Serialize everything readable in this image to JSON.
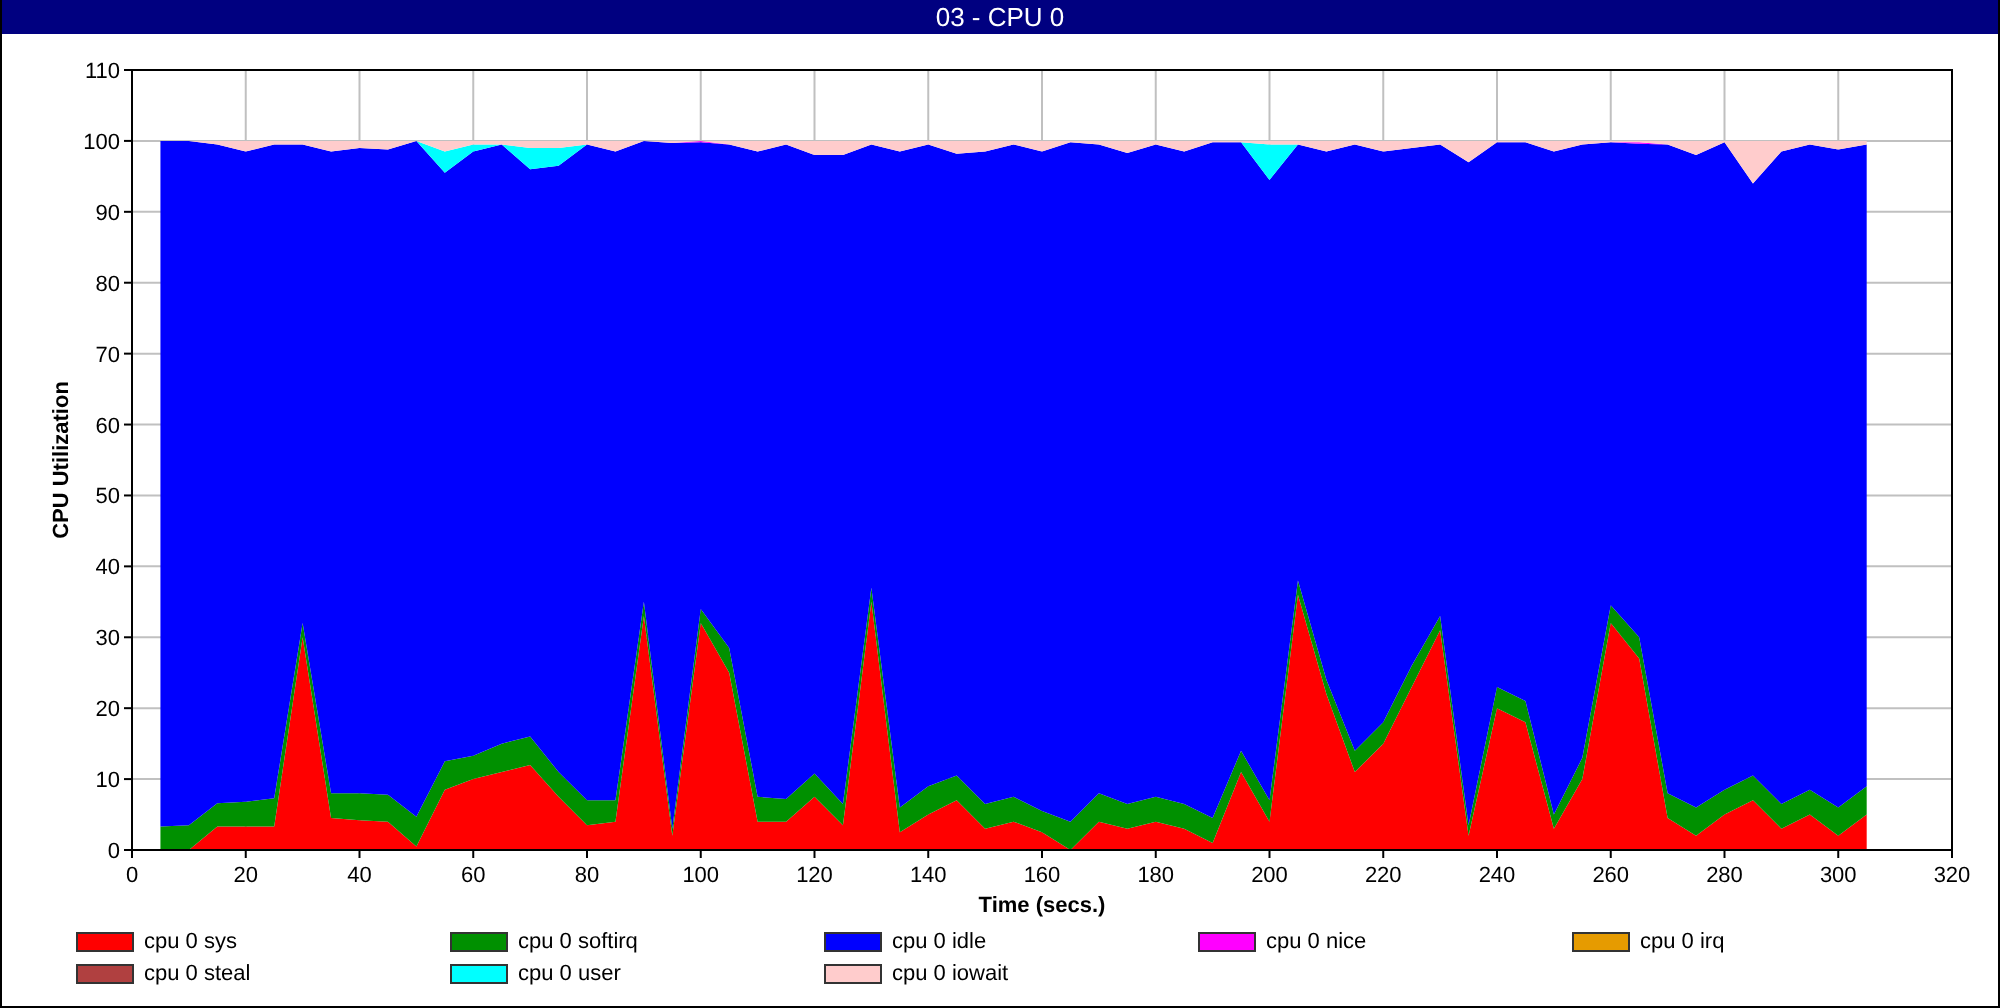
{
  "window": {
    "title": "03 - CPU 0"
  },
  "chart": {
    "chart_data": {
      "type": "area",
      "stacked": true,
      "grid": true,
      "xlabel": "Time (secs.)",
      "ylabel": "CPU Utilization",
      "x": [
        5,
        10,
        15,
        20,
        25,
        30,
        35,
        40,
        45,
        50,
        55,
        60,
        65,
        70,
        75,
        80,
        85,
        90,
        95,
        100,
        105,
        110,
        115,
        120,
        125,
        130,
        135,
        140,
        145,
        150,
        155,
        160,
        165,
        170,
        175,
        180,
        185,
        190,
        195,
        200,
        205,
        210,
        215,
        220,
        225,
        230,
        235,
        240,
        245,
        250,
        255,
        260,
        265,
        270,
        275,
        280,
        285,
        290,
        295,
        300,
        305
      ],
      "xlim": [
        0,
        320
      ],
      "ylim": [
        0,
        110
      ],
      "xticks": [
        0,
        20,
        40,
        60,
        80,
        100,
        120,
        140,
        160,
        180,
        200,
        220,
        240,
        260,
        280,
        300,
        320
      ],
      "yticks": [
        0,
        10,
        20,
        30,
        40,
        50,
        60,
        70,
        80,
        90,
        100,
        110
      ],
      "series": [
        {
          "name": "cpu 0 sys",
          "color": "#ff0000",
          "values": [
            null,
            0,
            3.3,
            3.3,
            3.3,
            30,
            4.5,
            4.2,
            4,
            0.5,
            8.5,
            10,
            11,
            12,
            7.5,
            3.5,
            4,
            33,
            2,
            32,
            25,
            4,
            4,
            7.5,
            3.5,
            35,
            2.5,
            5,
            7,
            3,
            4,
            2.5,
            0,
            4,
            3,
            4,
            3,
            1,
            11,
            4,
            36,
            22,
            11,
            15,
            23,
            31,
            2,
            20,
            18,
            3,
            10,
            32,
            27,
            4.5,
            2,
            5,
            7,
            3,
            5,
            2,
            5
          ]
        },
        {
          "name": "cpu 0 softirq",
          "color": "#009000",
          "values": [
            3.3,
            3.5,
            3.3,
            3.5,
            4,
            2,
            3.5,
            3.8,
            3.8,
            4.2,
            4,
            3.3,
            4,
            4,
            3.5,
            3.5,
            3,
            2,
            1,
            2,
            3.5,
            3.5,
            3.2,
            3.3,
            3,
            2,
            3.5,
            4,
            3.5,
            3.5,
            3.5,
            3,
            4,
            4,
            3.5,
            3.5,
            3.5,
            3.5,
            3,
            3,
            2,
            2,
            3,
            3,
            3,
            2,
            1.5,
            3,
            3,
            2,
            3,
            2.5,
            3,
            3.5,
            4,
            3.5,
            3.5,
            3.5,
            3.5,
            4,
            4
          ]
        },
        {
          "name": "cpu 0 idle",
          "color": "#0000ff",
          "values": [
            96.7,
            96.5,
            92.9,
            91.7,
            92.2,
            67.5,
            90.5,
            91,
            91,
            95.3,
            83,
            85.2,
            84.5,
            80,
            85.5,
            92.5,
            91.5,
            65,
            96.7,
            65.8,
            71,
            91,
            92.3,
            87.2,
            91.5,
            62.5,
            92.5,
            90.5,
            87.7,
            92,
            92,
            93,
            95.8,
            91.5,
            91.8,
            92,
            92,
            95.3,
            85.8,
            87.5,
            61.5,
            74.5,
            85.5,
            80.5,
            73,
            66.5,
            93.5,
            76.8,
            78.8,
            93.5,
            86.5,
            65.3,
            69.6,
            91.5,
            92,
            91.3,
            83.5,
            92,
            91,
            92.8,
            90.5
          ]
        },
        {
          "name": "cpu 0 nice",
          "color": "#ff00ff",
          "values": [
            null,
            null,
            null,
            null,
            null,
            null,
            null,
            null,
            null,
            null,
            null,
            null,
            null,
            null,
            null,
            null,
            null,
            null,
            0,
            0.2,
            0,
            null,
            null,
            null,
            null,
            null,
            null,
            null,
            null,
            null,
            null,
            null,
            null,
            null,
            null,
            null,
            null,
            null,
            null,
            null,
            null,
            null,
            null,
            null,
            null,
            null,
            null,
            null,
            null,
            null,
            null,
            0,
            0.2,
            0,
            null,
            null,
            null,
            null,
            null,
            null,
            null
          ]
        },
        {
          "name": "cpu 0 irq",
          "color": "#e69b00",
          "values": [
            null,
            null,
            null,
            null,
            null,
            null,
            null,
            null,
            null,
            null,
            null,
            null,
            null,
            null,
            null,
            null,
            null,
            null,
            null,
            null,
            null,
            null,
            null,
            null,
            null,
            null,
            null,
            null,
            null,
            null,
            null,
            null,
            null,
            null,
            null,
            null,
            null,
            null,
            null,
            null,
            null,
            null,
            null,
            null,
            null,
            null,
            null,
            null,
            null,
            null,
            null,
            null,
            null,
            null,
            null,
            null,
            null,
            null,
            null,
            null,
            null
          ]
        },
        {
          "name": "cpu 0 steal",
          "color": "#b04040",
          "values": [
            null,
            null,
            null,
            null,
            null,
            null,
            null,
            null,
            null,
            null,
            null,
            null,
            null,
            null,
            null,
            null,
            null,
            null,
            null,
            null,
            null,
            null,
            null,
            null,
            null,
            null,
            null,
            null,
            null,
            null,
            null,
            null,
            null,
            null,
            null,
            null,
            null,
            null,
            null,
            null,
            null,
            null,
            null,
            null,
            null,
            null,
            null,
            null,
            null,
            null,
            null,
            null,
            null,
            null,
            null,
            null,
            null,
            null,
            null,
            null,
            null
          ]
        },
        {
          "name": "cpu 0 user",
          "color": "#00ffff",
          "values": [
            null,
            null,
            null,
            null,
            null,
            null,
            null,
            null,
            null,
            0,
            3,
            1,
            0,
            3,
            2.5,
            0,
            null,
            null,
            null,
            null,
            null,
            null,
            null,
            null,
            null,
            null,
            null,
            null,
            null,
            null,
            null,
            null,
            null,
            null,
            null,
            null,
            null,
            null,
            0,
            5,
            0,
            null,
            null,
            null,
            null,
            null,
            null,
            null,
            null,
            null,
            null,
            null,
            null,
            null,
            null,
            null,
            null,
            null,
            null,
            null,
            null
          ]
        },
        {
          "name": "cpu 0 iowait",
          "color": "#ffcccc",
          "values": [
            null,
            0,
            0.5,
            1.5,
            0.5,
            0.5,
            1.5,
            1,
            1.2,
            0,
            1.5,
            0.5,
            0.5,
            1,
            1,
            0.5,
            1.5,
            0,
            0.3,
            0,
            0.5,
            1.5,
            0.5,
            2,
            2,
            0.5,
            1.5,
            0.5,
            1.8,
            1.5,
            0.5,
            1.5,
            0.2,
            0.5,
            1.7,
            0.5,
            1.5,
            0.2,
            0.2,
            0.5,
            0.5,
            1.5,
            0.5,
            1.5,
            1,
            0.5,
            3,
            0.2,
            0.2,
            1.5,
            0.5,
            0.2,
            0.2,
            0.5,
            2,
            0.2,
            6,
            1.5,
            0.5,
            1.2,
            0.5
          ]
        }
      ]
    }
  }
}
